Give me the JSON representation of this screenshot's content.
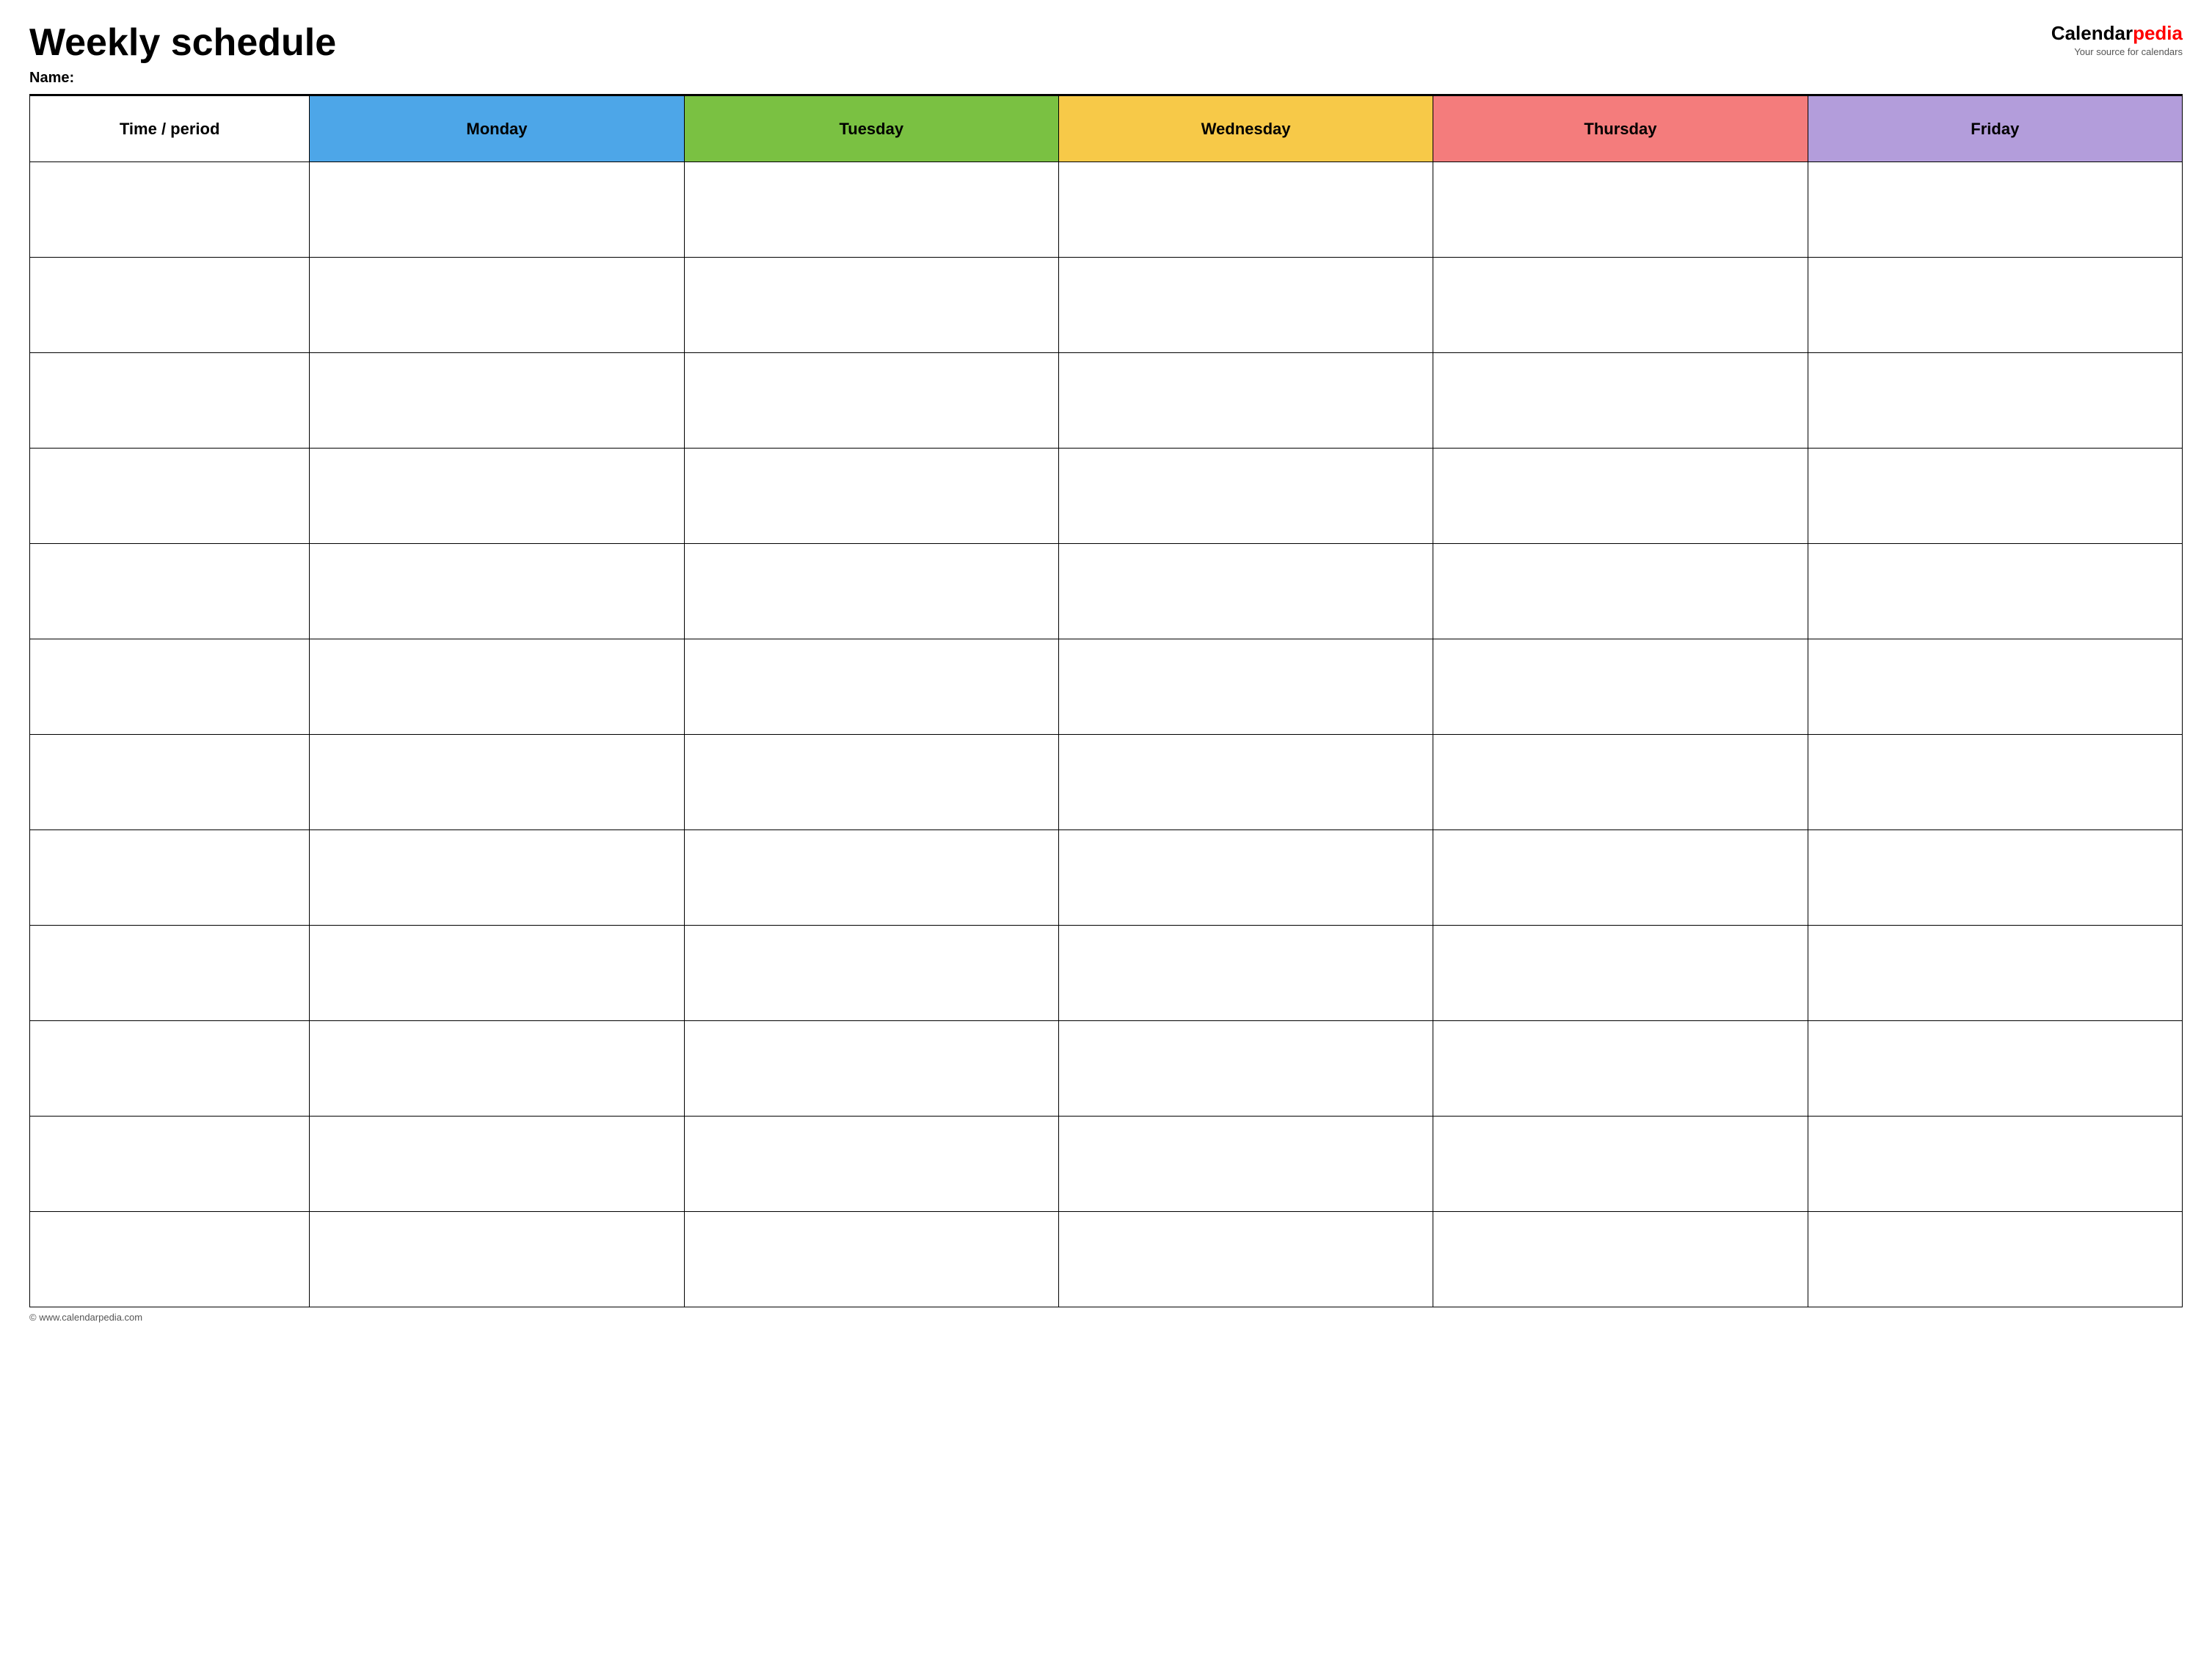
{
  "header": {
    "title": "Weekly schedule",
    "name_label": "Name:",
    "logo_calendar": "Calendar",
    "logo_pedia": "pedia",
    "logo_tagline": "Your source for calendars"
  },
  "table": {
    "columns": [
      {
        "id": "time",
        "label": "Time / period",
        "color": "#ffffff"
      },
      {
        "id": "monday",
        "label": "Monday",
        "color": "#4da6e8"
      },
      {
        "id": "tuesday",
        "label": "Tuesday",
        "color": "#7ac142"
      },
      {
        "id": "wednesday",
        "label": "Wednesday",
        "color": "#f7c948"
      },
      {
        "id": "thursday",
        "label": "Thursday",
        "color": "#f47c7c"
      },
      {
        "id": "friday",
        "label": "Friday",
        "color": "#b39ddb"
      }
    ],
    "row_count": 12
  },
  "footer": {
    "url": "© www.calendarpedia.com"
  }
}
